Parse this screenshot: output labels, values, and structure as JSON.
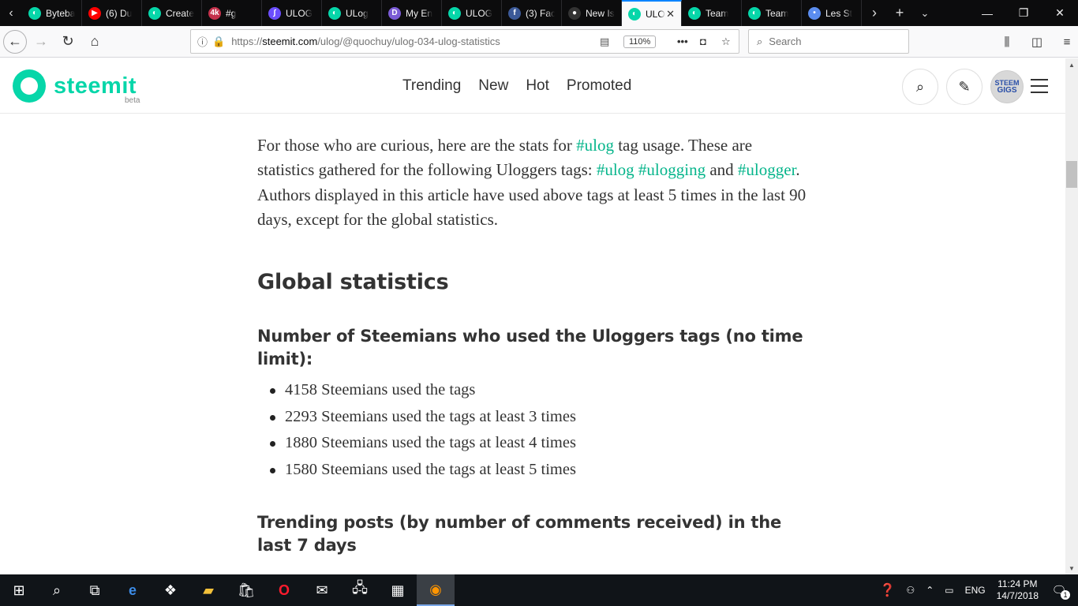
{
  "browser": {
    "tabs": [
      {
        "title": "Byteball",
        "favicon": "steemit-icon",
        "color": "#06d6a9"
      },
      {
        "title": "(6) Du",
        "favicon": "youtube-icon",
        "color": "#ff0000"
      },
      {
        "title": "Create",
        "favicon": "steemit-icon",
        "color": "#06d6a9"
      },
      {
        "title": "#g",
        "favicon": "4k-icon",
        "color": "#c4314b"
      },
      {
        "title": "ULOG",
        "favicon": "steemconnect-icon",
        "color": "#6b4eff"
      },
      {
        "title": "ULog",
        "favicon": "steemit-icon",
        "color": "#06d6a9"
      },
      {
        "title": "My En",
        "favicon": "d-icon",
        "color": "#7b5cd6"
      },
      {
        "title": "ULOG",
        "favicon": "steemit-icon",
        "color": "#06d6a9"
      },
      {
        "title": "(3) Fac",
        "favicon": "facebook-icon",
        "color": "#3b5998"
      },
      {
        "title": "New Is",
        "favicon": "github-icon",
        "color": "#333333"
      },
      {
        "title": "ULO",
        "favicon": "steemit-icon",
        "color": "#06d6a9",
        "active": true
      },
      {
        "title": "Team",
        "favicon": "steemit-icon",
        "color": "#06d6a9"
      },
      {
        "title": "Team",
        "favicon": "steemit-icon",
        "color": "#06d6a9"
      },
      {
        "title": "Les St",
        "favicon": "dot-icon",
        "color": "#5b8def"
      }
    ],
    "url_prefix": "https://",
    "url_host": "steemit.com",
    "url_path": "/ulog/@quochuy/ulog-034-ulog-statistics",
    "zoom": "110%",
    "search_placeholder": "Search"
  },
  "site": {
    "logo_text": "steemit",
    "logo_sub": "beta",
    "nav": [
      "Trending",
      "New",
      "Hot",
      "Promoted"
    ],
    "avatar_line1": "STEEM",
    "avatar_line2": "GIGS"
  },
  "article": {
    "intro_1": "For those who are curious, here are the stats for ",
    "tag_ulog": "#ulog",
    "intro_2": " tag usage. These are statistics gathered for the following Uloggers tags: ",
    "tag_ulog_2": "#ulog",
    "tag_ulogging": "#ulogging",
    "intro_and": " and ",
    "tag_ulogger": "#ulogger",
    "intro_end": ".",
    "authors_note": "Authors displayed in this article have used above tags at least 5 times in the last 90 days, except for the global statistics.",
    "section_title": "Global statistics",
    "subsection_1": "Number of Steemians who used the Uloggers tags (no time limit):",
    "stats": [
      "4158 Steemians used the tags",
      "2293 Steemians used the tags at least 3 times",
      "1880 Steemians used the tags at least 4 times",
      "1580 Steemians used the tags at least 5 times"
    ],
    "subsection_2": "Trending posts (by number of comments received) in the last 7 days"
  },
  "taskbar": {
    "language": "ENG",
    "time": "11:24 PM",
    "date": "14/7/2018",
    "notifications": "1"
  }
}
